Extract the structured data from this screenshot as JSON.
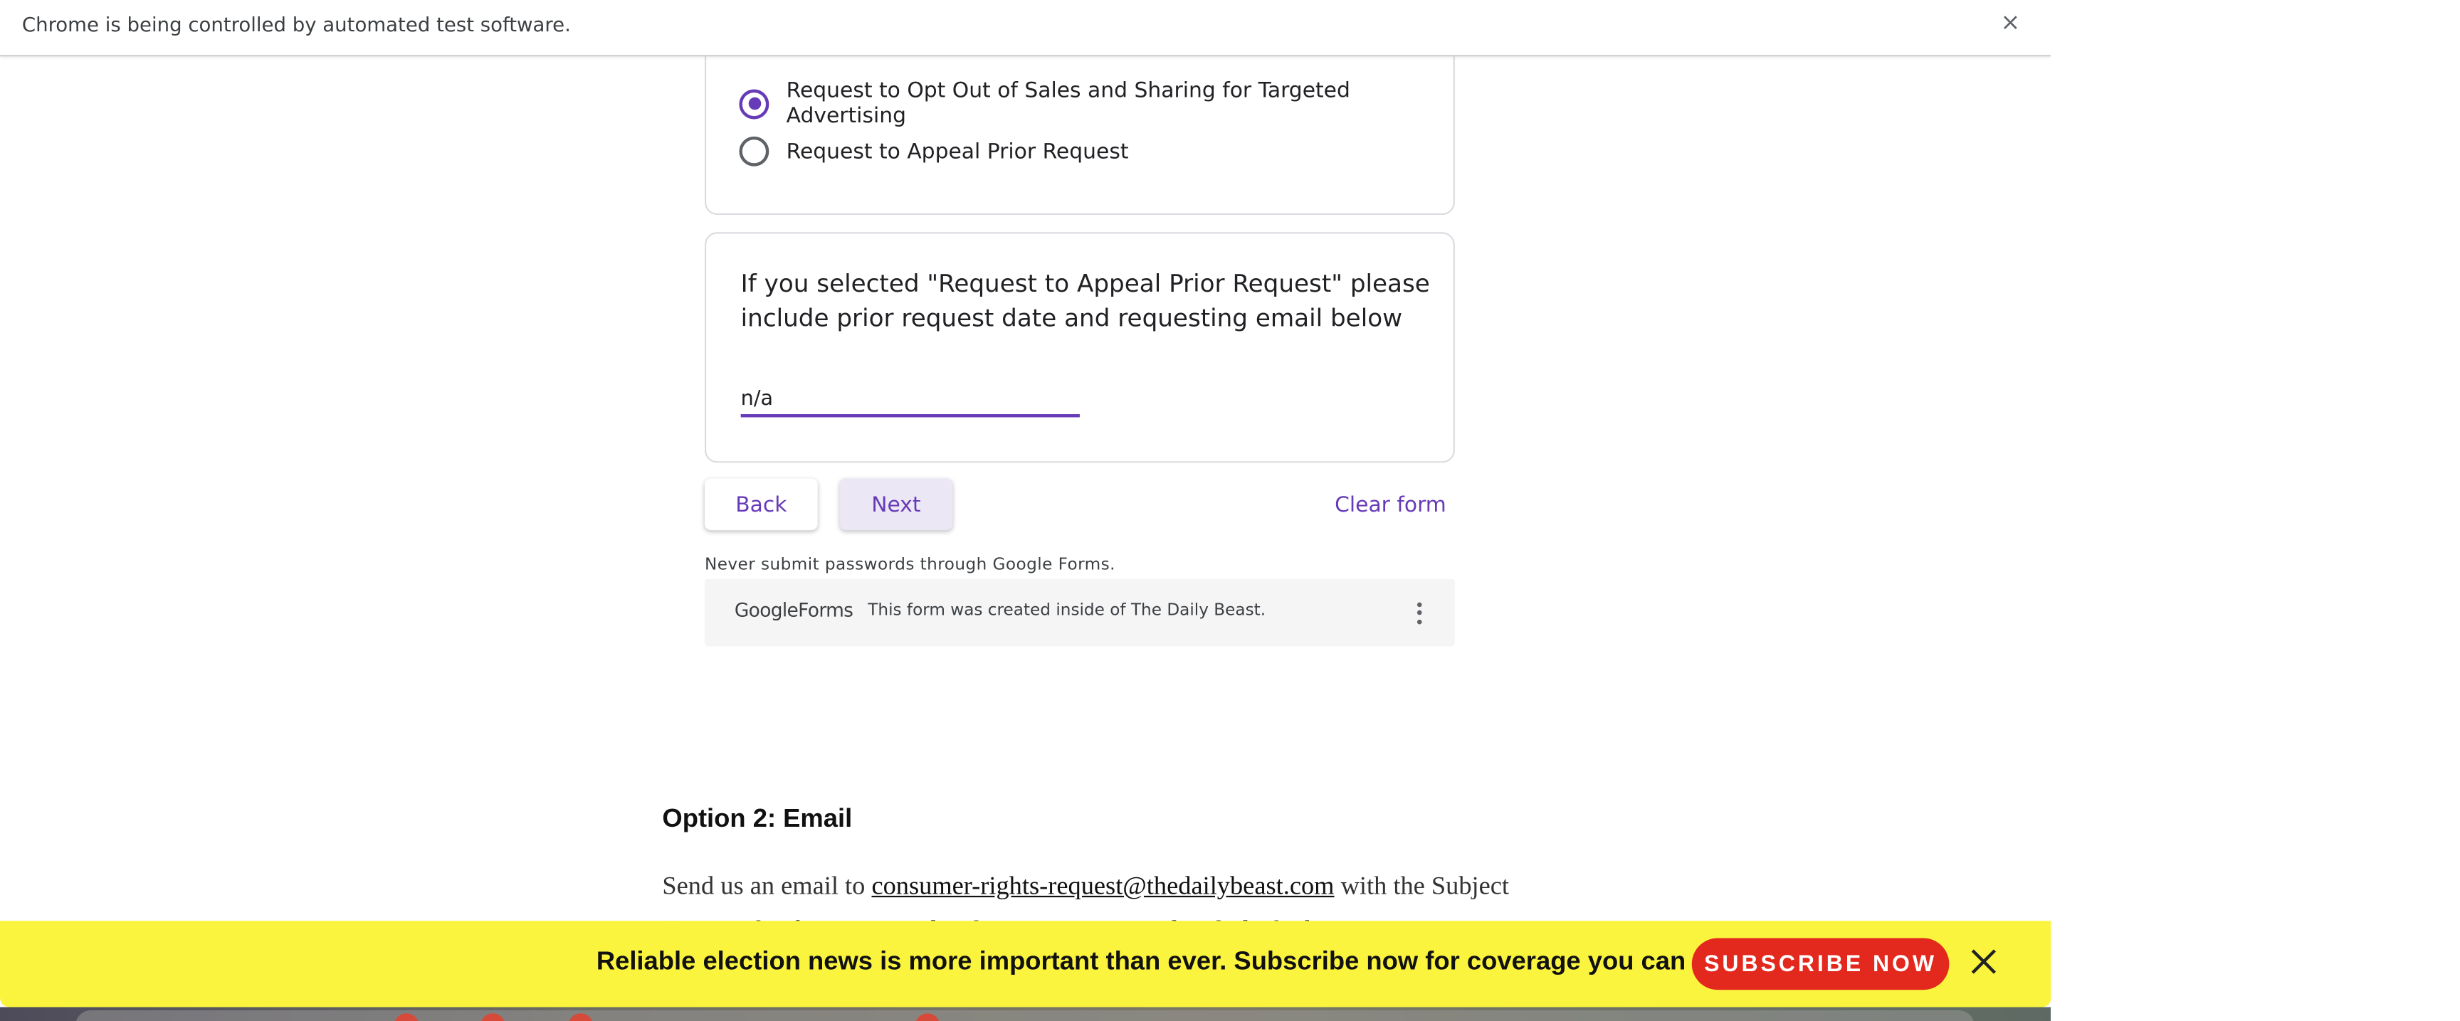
{
  "infobar": {
    "text": "Chrome is being controlled by automated test software.",
    "close_glyph": "×"
  },
  "form": {
    "radio_options": [
      {
        "label": "Request to Opt Out of Sales and Sharing for Targeted Advertising",
        "checked": true
      },
      {
        "label": "Request to Appeal Prior Request",
        "checked": false
      }
    ],
    "question": {
      "title": "If you selected \"Request to Appeal Prior Request\" please include prior request date and requesting email below",
      "answer": "n/a"
    },
    "buttons": {
      "back": "Back",
      "next": "Next",
      "clear": "Clear form"
    },
    "password_warning": "Never submit passwords through Google Forms.",
    "footer": {
      "logo": "GoogleForms",
      "created_inside": "This form was created inside of The Daily Beast."
    }
  },
  "article": {
    "heading": "Option 2: Email",
    "paragraph_prefix": "Send us an email to ",
    "email_link": "consumer-rights-request@thedailybeast.com",
    "paragraph_suffix": " with the Subject “Personal Information and Deletion Request” and include the browser ID provided"
  },
  "banner": {
    "text": "Reliable election news is more important than ever. Subscribe now for coverage you can count on.",
    "cta": "SUBSCRIBE NOW",
    "background": "#fbf43e",
    "cta_color": "#e3281e"
  },
  "colors": {
    "accent": "#673ab7"
  },
  "icons": {
    "infobar_close": "close-icon",
    "banner_close": "close-icon",
    "footer_menu": "more-vert-icon"
  }
}
